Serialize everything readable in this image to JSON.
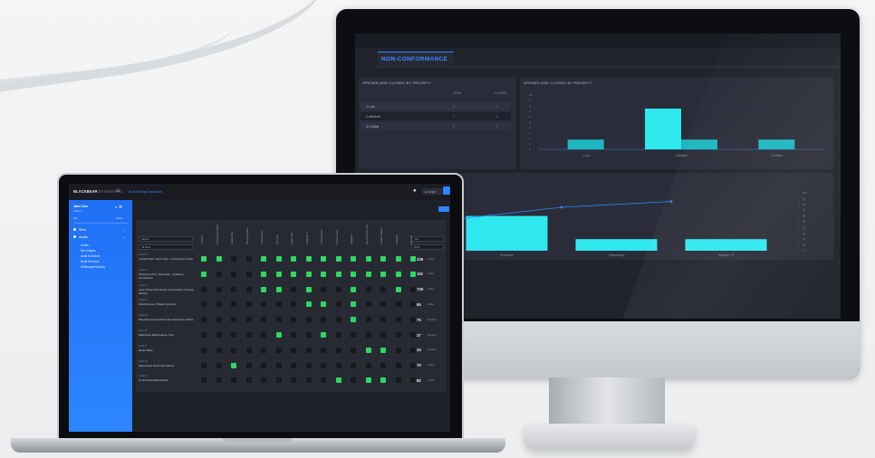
{
  "colors": {
    "accent": "#2f84ff",
    "bar": "#2ee8ee",
    "bar_dark": "#1db7c0",
    "matrix_on": "#2fd863",
    "matrix_off": "#17191f"
  },
  "monitor": {
    "tab": "NON-CONFORMANCE",
    "side_icons": [
      "filter-icon",
      "gear-icon",
      "user-icon"
    ],
    "table_panel": {
      "title": "OPENED AND CLOSED BY PRIORITY",
      "columns": [
        "OPEN",
        "CLOSED"
      ],
      "rows": [
        {
          "label": "1-Low",
          "open": "3",
          "closed": "1"
        },
        {
          "label": "2-Medium",
          "open": "7",
          "closed": "4"
        },
        {
          "label": "3-Critical",
          "open": "4",
          "closed": "1"
        }
      ]
    },
    "bar_panel": {
      "title": "OPENED AND CLOSED BY PRIORITY",
      "chart_data": {
        "type": "bar",
        "categories": [
          "1-Low",
          "2-Medium",
          "3-Critical"
        ],
        "series": [
          {
            "values": [
              0,
              7.5,
              0
            ]
          },
          {
            "values": [
              1.8,
              1.8,
              1.8
            ]
          }
        ],
        "ylim": [
          0,
          10
        ],
        "yticks": [
          "10",
          "9",
          "8",
          "7",
          "6",
          "5",
          "4",
          "3",
          "2",
          "1",
          "0"
        ]
      }
    },
    "pareto_panel": {
      "title": "NON-CONFORMANCE ROOT CAUSES",
      "chart_data": {
        "type": "bar",
        "categories": [
          "",
          "Procedure",
          "Competency",
          "Security - IT"
        ],
        "series": [
          {
            "values": [
              7,
              6,
              2,
              2
            ]
          },
          {
            "values": [
              52,
              75,
              85,
              98
            ]
          }
        ],
        "right_ticks": [
          "100",
          "90",
          "80",
          "70",
          "60",
          "50",
          "40",
          "30",
          "20",
          "10",
          "0"
        ]
      }
    }
  },
  "laptop": {
    "logo_bold": "BLACKBEAR",
    "logo_light": "DASHBOARD",
    "breadcrumb": "Audit Findings Dashboard",
    "user_label": "Jo Smith",
    "sidebar": {
      "name": "Jane Doe",
      "role": "Admin",
      "meta_left": "Site",
      "meta_right": "Active",
      "items": [
        {
          "label": "Sites"
        },
        {
          "label": "Audits"
        }
      ],
      "subitems": [
        "Audits",
        "Non-Majors",
        "Audit Schedule",
        "Audit Services",
        "Whitepaper/Library"
      ]
    },
    "filters": {
      "left_top": "Search",
      "left_bottom": "All Sites",
      "right_top": "Year",
      "right_bottom": "2019"
    },
    "columns": [
      "Process",
      "Procedures Followed",
      "Leadership",
      "Documentation",
      "Competency",
      "Records",
      "Equipment",
      "Calibration",
      "Training Plan",
      "Environment",
      "Suppliers",
      "Document Control",
      "Incident Report",
      "Hazards",
      "Sign-off"
    ],
    "rows": [
      {
        "tag": "Audit 01",
        "label": "Crystal Falls / Acme Site - Construction Audit",
        "count": "236",
        "status": "Active",
        "cells": [
          1,
          1,
          0,
          0,
          1,
          1,
          1,
          1,
          1,
          1,
          1,
          1,
          1,
          1,
          1
        ]
      },
      {
        "tag": "Audit 02",
        "label": "Westwood Ave / Riverside - Quarterly Compliance",
        "count": "161",
        "status": "Active",
        "cells": [
          1,
          0,
          0,
          0,
          1,
          1,
          1,
          1,
          1,
          1,
          1,
          1,
          1,
          1,
          1
        ]
      },
      {
        "tag": "Audit 03",
        "label": "Lake Trinity Civil Works Construction / Annual Review",
        "count": "726",
        "status": "Active",
        "cells": [
          0,
          0,
          0,
          0,
          1,
          1,
          0,
          1,
          0,
          0,
          1,
          0,
          0,
          1,
          0
        ]
      },
      {
        "tag": "Audit 04",
        "label": "Infrastructure / Waste Systems",
        "count": "65",
        "status": "Active",
        "cells": [
          0,
          0,
          0,
          0,
          0,
          0,
          0,
          1,
          1,
          0,
          1,
          0,
          0,
          0,
          0
        ]
      },
      {
        "tag": "Audit 05",
        "label": "Riverside Construction Site Expansion Works",
        "count": "75",
        "status": "Pending",
        "cells": [
          0,
          0,
          0,
          0,
          0,
          0,
          0,
          0,
          0,
          0,
          1,
          0,
          0,
          0,
          0
        ]
      },
      {
        "tag": "Audit 06",
        "label": "Waterfront Maintenance Yard",
        "count": "37",
        "status": "Pending",
        "cells": [
          0,
          0,
          0,
          0,
          0,
          1,
          0,
          0,
          1,
          0,
          0,
          0,
          0,
          0,
          0
        ]
      },
      {
        "tag": "Audit 07",
        "label": "Head Office",
        "count": "33",
        "status": "Pending",
        "cells": [
          0,
          0,
          0,
          0,
          0,
          0,
          0,
          0,
          0,
          0,
          0,
          1,
          1,
          0,
          0
        ]
      },
      {
        "tag": "Audit 08",
        "label": "Warehouse North Operations",
        "count": "79",
        "status": "Active",
        "cells": [
          0,
          0,
          1,
          0,
          0,
          0,
          0,
          0,
          0,
          0,
          0,
          0,
          0,
          0,
          0
        ]
      },
      {
        "tag": "Audit 09",
        "label": "Central Depot/Workshop",
        "count": "80",
        "status": "Active",
        "cells": [
          0,
          0,
          0,
          0,
          0,
          0,
          0,
          0,
          0,
          1,
          0,
          1,
          1,
          0,
          0
        ]
      }
    ]
  }
}
